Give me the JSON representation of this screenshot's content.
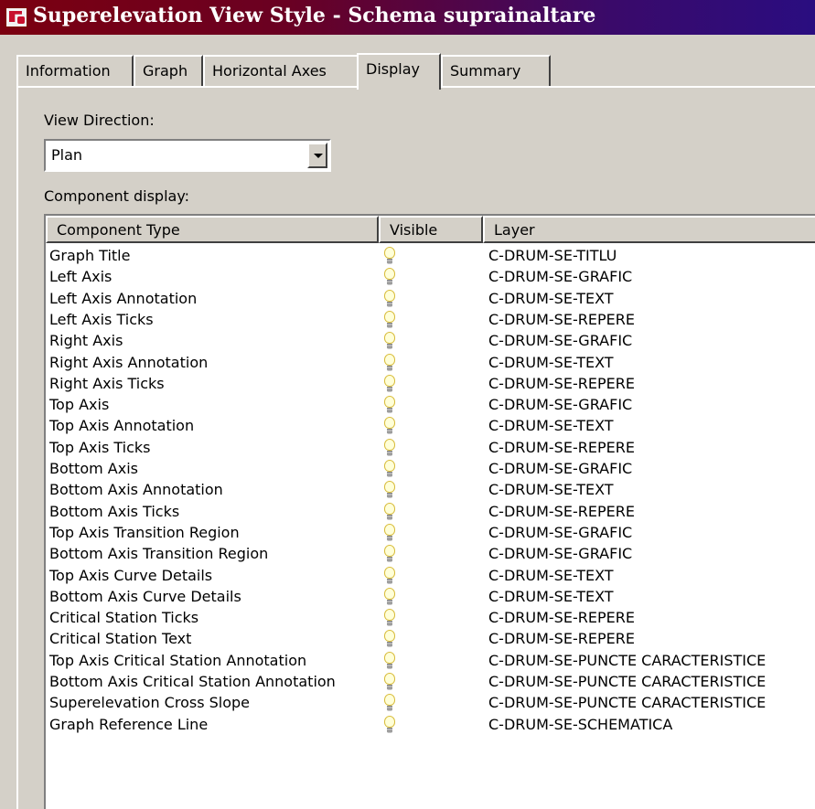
{
  "window": {
    "title": "Superelevation View Style - Schema suprainaltare"
  },
  "tabs": [
    {
      "label": "Information"
    },
    {
      "label": "Graph"
    },
    {
      "label": "Horizontal Axes"
    },
    {
      "label": "Display"
    },
    {
      "label": "Summary"
    }
  ],
  "active_tab": "Display",
  "display": {
    "view_direction_label": "View Direction:",
    "view_direction_value": "Plan",
    "component_display_label": "Component display:",
    "columns": {
      "type": "Component Type",
      "visible": "Visible",
      "layer": "Layer"
    },
    "rows": [
      {
        "type": "Graph Title",
        "layer": "C-DRUM-SE-TITLU"
      },
      {
        "type": "Left Axis",
        "layer": "C-DRUM-SE-GRAFIC"
      },
      {
        "type": "Left Axis Annotation",
        "layer": "C-DRUM-SE-TEXT"
      },
      {
        "type": "Left Axis Ticks",
        "layer": "C-DRUM-SE-REPERE"
      },
      {
        "type": "Right Axis",
        "layer": "C-DRUM-SE-GRAFIC"
      },
      {
        "type": "Right Axis Annotation",
        "layer": "C-DRUM-SE-TEXT"
      },
      {
        "type": "Right Axis Ticks",
        "layer": "C-DRUM-SE-REPERE"
      },
      {
        "type": "Top Axis",
        "layer": "C-DRUM-SE-GRAFIC"
      },
      {
        "type": "Top Axis Annotation",
        "layer": "C-DRUM-SE-TEXT"
      },
      {
        "type": "Top Axis Ticks",
        "layer": "C-DRUM-SE-REPERE"
      },
      {
        "type": "Bottom Axis",
        "layer": "C-DRUM-SE-GRAFIC"
      },
      {
        "type": "Bottom Axis Annotation",
        "layer": "C-DRUM-SE-TEXT"
      },
      {
        "type": "Bottom Axis Ticks",
        "layer": "C-DRUM-SE-REPERE"
      },
      {
        "type": "Top Axis Transition Region",
        "layer": "C-DRUM-SE-GRAFIC"
      },
      {
        "type": "Bottom Axis Transition Region",
        "layer": "C-DRUM-SE-GRAFIC"
      },
      {
        "type": "Top Axis Curve Details",
        "layer": "C-DRUM-SE-TEXT"
      },
      {
        "type": "Bottom Axis Curve Details",
        "layer": "C-DRUM-SE-TEXT"
      },
      {
        "type": "Critical Station Ticks",
        "layer": "C-DRUM-SE-REPERE"
      },
      {
        "type": "Critical Station Text",
        "layer": "C-DRUM-SE-REPERE"
      },
      {
        "type": "Top Axis Critical Station Annotation",
        "layer": "C-DRUM-SE-PUNCTE CARACTERISTICE"
      },
      {
        "type": "Bottom Axis Critical Station Annotation",
        "layer": "C-DRUM-SE-PUNCTE CARACTERISTICE"
      },
      {
        "type": "Superelevation Cross Slope",
        "layer": "C-DRUM-SE-PUNCTE CARACTERISTICE"
      },
      {
        "type": "Graph Reference Line",
        "layer": "C-DRUM-SE-SCHEMATICA"
      }
    ]
  },
  "colors": {
    "title_gradient_start": "#7b0010",
    "title_gradient_end": "#2a0d80",
    "dialog_face": "#d4d0c8",
    "bulb_on": "#ffffd8"
  },
  "icons": {
    "app": "civil3d-app-icon",
    "visible_on": "lightbulb-on-icon"
  }
}
